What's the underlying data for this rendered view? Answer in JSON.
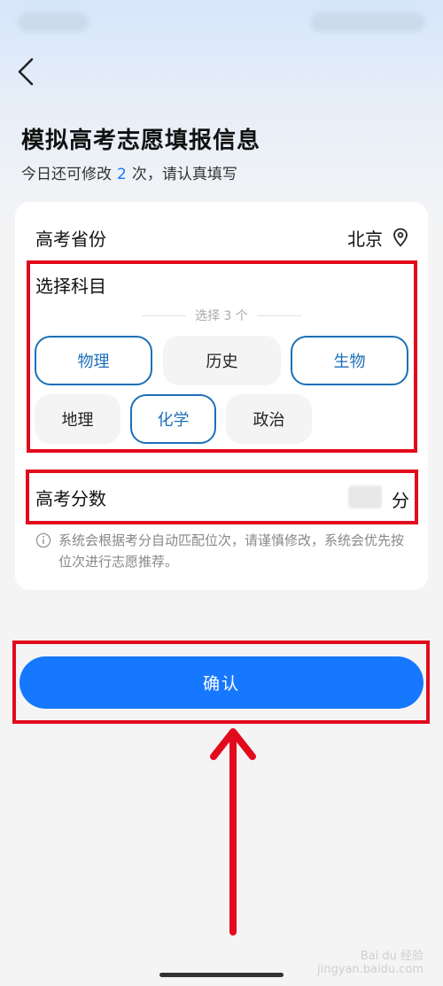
{
  "header": {
    "title": "模拟高考志愿填报信息",
    "subtitle_prefix": "今日还可修改",
    "subtitle_count": "2",
    "subtitle_suffix": "次，请认真填写"
  },
  "province": {
    "label": "高考省份",
    "value": "北京",
    "icon": "location-pin-icon"
  },
  "subjects": {
    "title": "选择科目",
    "hint": "选择 3 个",
    "options": [
      {
        "label": "物理",
        "selected": true
      },
      {
        "label": "历史",
        "selected": false
      },
      {
        "label": "生物",
        "selected": true
      },
      {
        "label": "地理",
        "selected": false
      },
      {
        "label": "化学",
        "selected": true
      },
      {
        "label": "政治",
        "selected": false
      }
    ]
  },
  "score": {
    "label": "高考分数",
    "unit": "分"
  },
  "note": "系统会根据考分自动匹配位次，请谨慎修改，系统会优先按位次进行志愿推荐。",
  "confirm_label": "确认",
  "watermark": "Bai du 经验\njingyan.baidu.com",
  "colors": {
    "accent": "#1677ff",
    "selected_chip": "#1d6fb8",
    "annotation_red": "#e10b1c"
  }
}
